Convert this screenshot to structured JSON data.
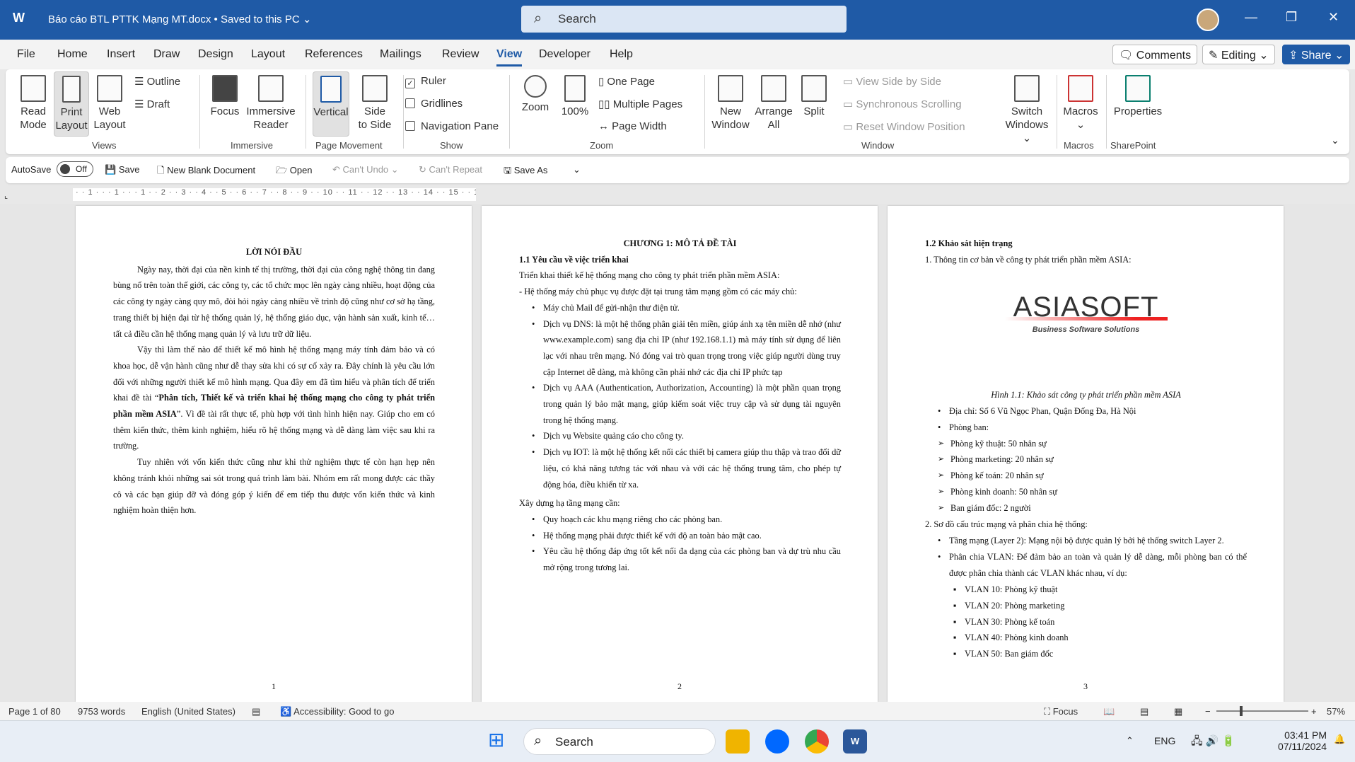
{
  "titlebar": {
    "doc_title": "Báo cáo BTL PTTK Mạng MT.docx • Saved to this PC ⌄",
    "search_placeholder": "Search"
  },
  "menu": {
    "tabs": [
      "File",
      "Home",
      "Insert",
      "Draw",
      "Design",
      "Layout",
      "References",
      "Mailings",
      "Review",
      "View",
      "Developer",
      "Help"
    ],
    "active": "View",
    "comments": "Comments",
    "editing": "Editing ⌄",
    "share": "Share ⌄"
  },
  "ribbon": {
    "views": {
      "read_mode": [
        "Read",
        "Mode"
      ],
      "print_layout": [
        "Print",
        "Layout"
      ],
      "web_layout": [
        "Web",
        "Layout"
      ],
      "outline": "Outline",
      "draft": "Draft",
      "group": "Views"
    },
    "immersive": {
      "focus": "Focus",
      "immersive_reader": [
        "Immersive",
        "Reader"
      ],
      "group": "Immersive"
    },
    "page_movement": {
      "vertical": "Vertical",
      "side_to_side": [
        "Side",
        "to Side"
      ],
      "group": "Page Movement"
    },
    "show": {
      "ruler": "Ruler",
      "gridlines": "Gridlines",
      "navigation_pane": "Navigation Pane",
      "ruler_checked": true,
      "gridlines_checked": false,
      "navigation_checked": false,
      "group": "Show"
    },
    "zoom": {
      "zoom": "Zoom",
      "hundred": "100%",
      "one_page": "One Page",
      "multiple_pages": "Multiple Pages",
      "page_width": "Page Width",
      "group": "Zoom"
    },
    "window": {
      "new_window": [
        "New",
        "Window"
      ],
      "arrange_all": [
        "Arrange",
        "All"
      ],
      "split": "Split",
      "view_side": "View Side by Side",
      "sync_scroll": "Synchronous Scrolling",
      "reset_pos": "Reset Window Position",
      "switch_windows": [
        "Switch",
        "Windows ⌄"
      ],
      "group": "Window"
    },
    "macros": {
      "macros": "Macros",
      "group": "Macros"
    },
    "sharepoint": {
      "properties": "Properties",
      "group": "SharePoint"
    }
  },
  "qat": {
    "autosave": "AutoSave",
    "autosave_state": "Off",
    "save": "Save",
    "new_blank": "New Blank Document",
    "open": "Open",
    "cant_undo": "Can't Undo",
    "cant_repeat": "Can't Repeat",
    "save_as": "Save As"
  },
  "ruler": {
    "ticks": "· · 1 · · · 1 · · · 1 · · 2 · · 3 · · 4 · · 5 · · 6 · · 7 · · 8 · · 9 · · 10 · · 11 · · 12 · · 13 · · 14 · · 15 · · 1"
  },
  "pages": [
    {
      "title": "LỜI NÓI ĐẦU",
      "p1": "Ngày nay, thời đại của nền kinh tế thị trường, thời đại của công nghệ thông tin đang bùng nổ trên toàn thế giới, các công ty, các tổ chức mọc lên ngày càng nhiều, hoạt động của các công ty ngày càng quy mô, đòi hỏi ngày càng nhiều về trình độ cũng như cơ sở hạ tầng, trang thiết bị hiện đại từ hệ thống quản lý, hệ thống giáo dục, vận hành sản xuất, kinh tế… tất cả điều cần hệ thống mạng quản lý và lưu trữ dữ liệu.",
      "p2a": "Vậy thì làm thế nào để thiết kế mô hình hệ thống mạng máy tính đảm bảo và có khoa học, dễ vận hành cũng như dễ thay sửa khi có sự cố xảy ra. Đây chính là yêu cầu lớn đối với những người thiết kế mô hình mạng. Qua đây em đã tìm hiểu và phân tích để triển khai đề tài “",
      "p2b": "Phân tích, Thiết kế và triển khai hệ thống mạng cho công ty phát triển phần mềm ASIA",
      "p2c": "”. Vì đề tài rất thực tế, phù hợp với tình hình hiện nay. Giúp cho em có thêm kiến thức, thêm kinh nghiệm, hiểu rõ hệ thống mạng và dễ dàng làm việc sau khi ra trường.",
      "p3": "Tuy nhiên với vốn kiến thức cũng như khi thử nghiệm thực tế còn hạn hẹp nên không tránh khỏi những sai sót trong quá trình làm bài. Nhóm em rất mong được các thầy cô và các bạn giúp đỡ và đóng góp ý kiến để em tiếp thu được vốn kiến thức và kinh nghiệm hoàn thiện hơn.",
      "number": "1"
    },
    {
      "title": "CHƯƠNG 1:  MÔ TẢ ĐỀ TÀI",
      "heading": "1.1 Yêu cầu về việc triển khai",
      "intro": "Triển khai thiết kế hệ thống mạng cho công ty phát triển phần mềm ASIA:",
      "intro2": "- Hệ thống máy chủ phục vụ được đặt tại trung tâm mạng gồm có các máy chủ:",
      "servers": [
        "Máy chủ Mail để gửi-nhận thư điện tử.",
        "Dịch vụ DNS: là một hệ thống phân giải tên miền, giúp ánh xạ tên miền dễ nhớ (như www.example.com) sang địa chỉ IP (như 192.168.1.1) mà máy tính sử dụng để liên lạc với nhau trên mạng. Nó đóng vai trò quan trọng trong việc giúp người dùng truy cập Internet dễ dàng, mà không cần phải nhớ các địa chỉ IP phức tạp",
        "Dịch vụ AAA (Authentication, Authorization, Accounting) là một phần quan trọng trong quản lý bảo mật mạng, giúp kiểm soát việc truy cập và sử dụng tài nguyên trong hệ thống mạng.",
        "Dịch vụ Website quảng cáo cho công ty.",
        "Dịch vụ IOT: là một hệ thống kết nối các thiết bị camera giúp thu thập và trao đổi dữ liệu, có khả năng tương tác với nhau và với các hệ thống trung tâm, cho phép tự động hóa, điều khiển từ xa."
      ],
      "infra": "Xây dựng hạ tầng mạng cần:",
      "infra_items": [
        "Quy hoạch các khu mạng riêng cho các phòng ban.",
        "Hệ thống mạng phải được thiết kế với độ an toàn bảo mật cao.",
        "Yêu cầu hệ thống đáp ứng tốt kết nối đa dạng của các phòng ban và dự trù nhu cầu mở rộng trong tương lai."
      ],
      "number": "2"
    },
    {
      "heading": "1.2 Khảo sát hiện trạng",
      "item1": "1. Thông tin cơ bản về công ty phát triển phần mềm ASIA:",
      "logo": {
        "name": "ASIASOFT",
        "tagline": "Business Software Solutions"
      },
      "caption": "Hình 1.1: Khảo sát công ty phát triển phần mềm ASIA",
      "address": "Địa chỉ: Số 6 Vũ Ngọc Phan, Quận Đống Đa, Hà Nội",
      "departments_label": "Phòng ban:",
      "departments": [
        "Phòng kỹ thuật: 50 nhân sự",
        "Phòng marketing: 20 nhân sự",
        "Phòng kế toán: 20 nhân sự",
        "Phòng kinh doanh: 50 nhân sự",
        "Ban giám đốc: 2 người"
      ],
      "item2": "2. Sơ đồ cấu trúc mạng và phân chia hệ thống:",
      "layer": "Tầng mạng (Layer 2): Mạng nội bộ được quản lý bởi hệ thống switch Layer 2.",
      "vlan_intro": "Phân chia VLAN: Để đảm bảo an toàn và quản lý dễ dàng, mỗi phòng ban có thể được phân chia thành các VLAN khác nhau, ví dụ:",
      "vlans": [
        "VLAN 10: Phòng kỹ thuật",
        "VLAN 20: Phòng marketing",
        "VLAN 30: Phòng kế toán",
        "VLAN 40: Phòng kinh doanh",
        "VLAN 50: Ban giám đốc"
      ],
      "number": "3"
    }
  ],
  "status": {
    "page": "Page 1 of 80",
    "words": "9753 words",
    "language": "English (United States)",
    "accessibility": "Accessibility: Good to go",
    "focus": "Focus",
    "zoom": "57%",
    "zoom_fraction": 0.57
  },
  "taskbar": {
    "search": "Search",
    "lang": "ENG",
    "time": "03:41 PM",
    "date": "07/11/2024"
  },
  "colors": {
    "brand": "#1f5aa6"
  }
}
